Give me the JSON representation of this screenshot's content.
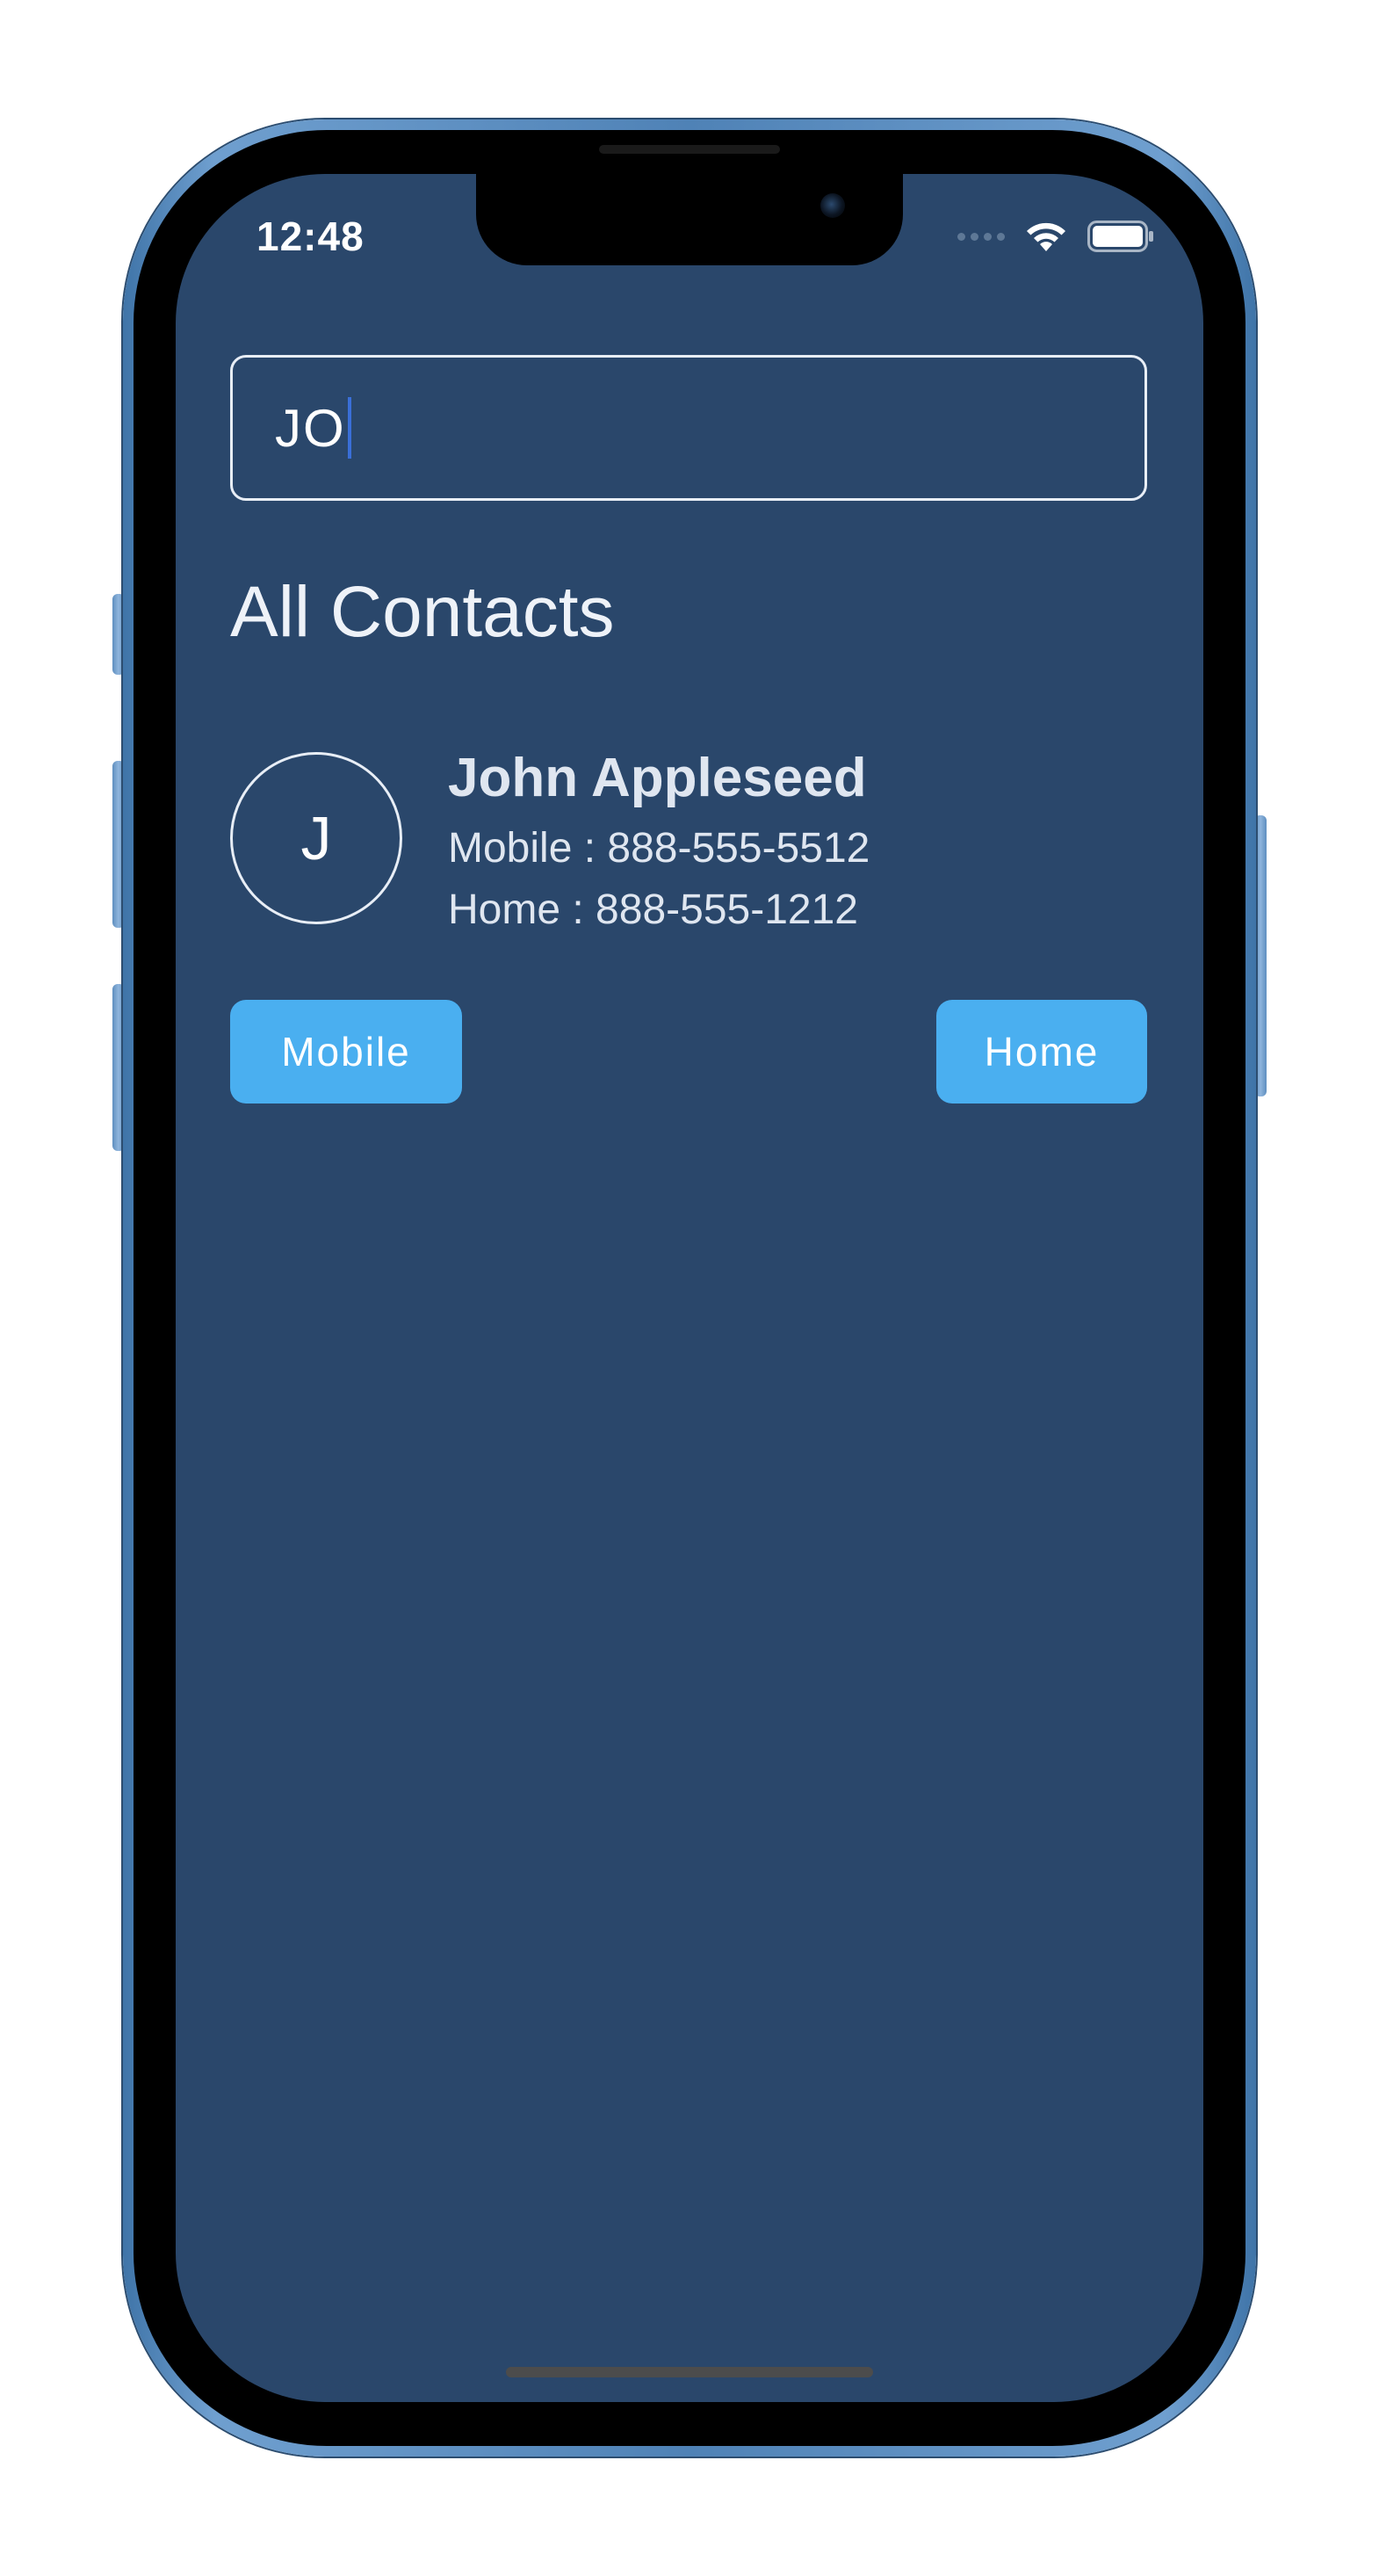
{
  "status_bar": {
    "time": "12:48"
  },
  "search": {
    "value": "JO"
  },
  "section_title": "All Contacts",
  "contacts": [
    {
      "initial": "J",
      "name": "John Appleseed",
      "mobile_line": "Mobile : 888-555-5512",
      "home_line": "Home : 888-555-1212"
    }
  ],
  "actions": {
    "mobile_label": "Mobile",
    "home_label": "Home"
  },
  "colors": {
    "background": "#2a476b",
    "accent_button": "#4aaff0",
    "text": "#dfe6f0"
  },
  "icons": [
    "signal-icon",
    "wifi-icon",
    "battery-icon"
  ]
}
